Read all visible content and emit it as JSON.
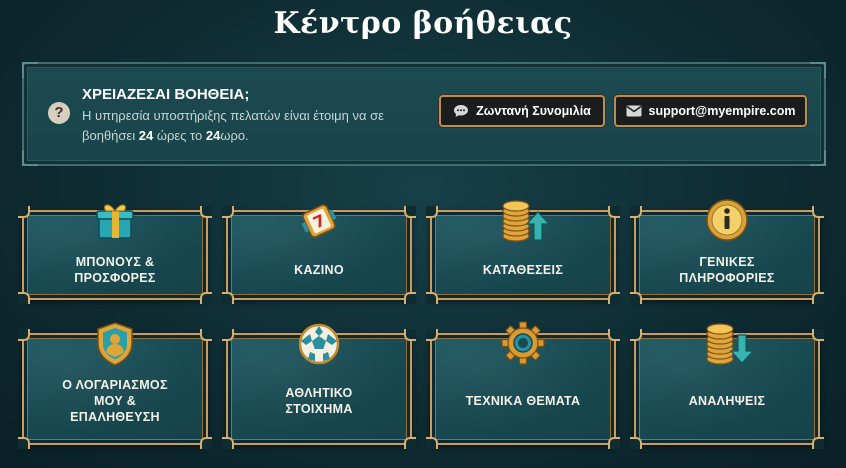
{
  "page": {
    "title": "Κέντρο βοήθειας"
  },
  "help": {
    "heading": "ΧΡΕΙΑΖΕΣΑΙ ΒΟΗΘΕΙΑ;",
    "text_part1": "Η υπηρεσία υποστήριξης πελατών είναι έτοιμη να σε βοηθήσει",
    "text_bold1": "24",
    "text_part2": "ώρες το",
    "text_bold2": "24",
    "text_part3": "ωρο."
  },
  "buttons": {
    "chat_label": "Ζωντανή Συνομιλία",
    "email_label": "support@myempire.com"
  },
  "categories": [
    {
      "line1": "ΜΠΟΝΟΥΣ &",
      "line2": "ΠΡΟΣΦΟΡΕΣ",
      "line3": "",
      "icon": "gift-box-icon"
    },
    {
      "line1": "ΚΑΖΙΝΟ",
      "line2": "",
      "line3": "",
      "icon": "slot-reel-icon"
    },
    {
      "line1": "ΚΑΤΑΘΕΣΕΙΣ",
      "line2": "",
      "line3": "",
      "icon": "coins-deposit-icon"
    },
    {
      "line1": "ΓΕΝΙΚΕΣ",
      "line2": "ΠΛΗΡΟΦΟΡΙΕΣ",
      "line3": "",
      "icon": "info-icon"
    },
    {
      "line1": "Ο ΛΟΓΑΡΙΑΣΜΟΣ",
      "line2": "ΜΟΥ &",
      "line3": "ΕΠΑΛΗΘΕΥΣΗ",
      "icon": "account-shield-icon"
    },
    {
      "line1": "ΑΘΛΗΤΙΚΟ",
      "line2": "ΣΤΟΙΧΗΜΑ",
      "line3": "",
      "icon": "football-icon"
    },
    {
      "line1": "ΤΕΧΝΙΚΑ ΘΕΜΑΤΑ",
      "line2": "",
      "line3": "",
      "icon": "gear-icon"
    },
    {
      "line1": "ΑΝΑΛΗΨΕΙΣ",
      "line2": "",
      "line3": "",
      "icon": "coins-withdraw-icon"
    }
  ],
  "colors": {
    "accent_gold": "#c79c5c",
    "arrow_teal": "#38b3b0",
    "background": "#0f2c33"
  }
}
